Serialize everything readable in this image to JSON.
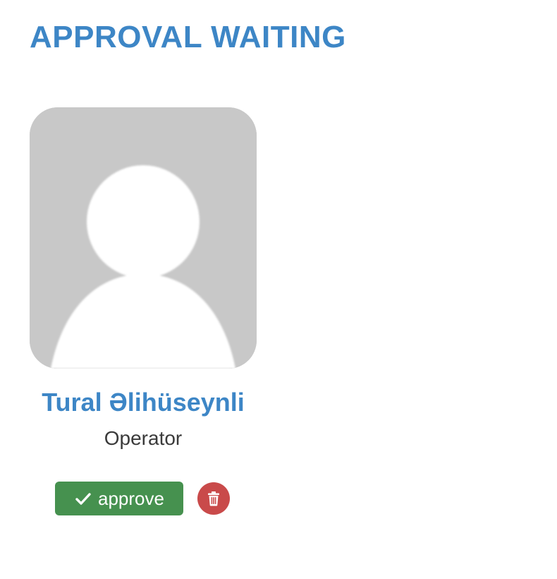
{
  "page": {
    "title": "APPROVAL WAITING"
  },
  "user_card": {
    "name": "Tural Əlihüseynli",
    "role": "Operator",
    "avatar_icon": "default-user-avatar",
    "approve_label": "approve",
    "approve_icon": "check-icon",
    "delete_icon": "trash-icon"
  },
  "colors": {
    "accent": "#3d86c6",
    "approve": "#46914f",
    "delete": "#c94a4a",
    "avatar_bg": "#c8c8c8"
  }
}
